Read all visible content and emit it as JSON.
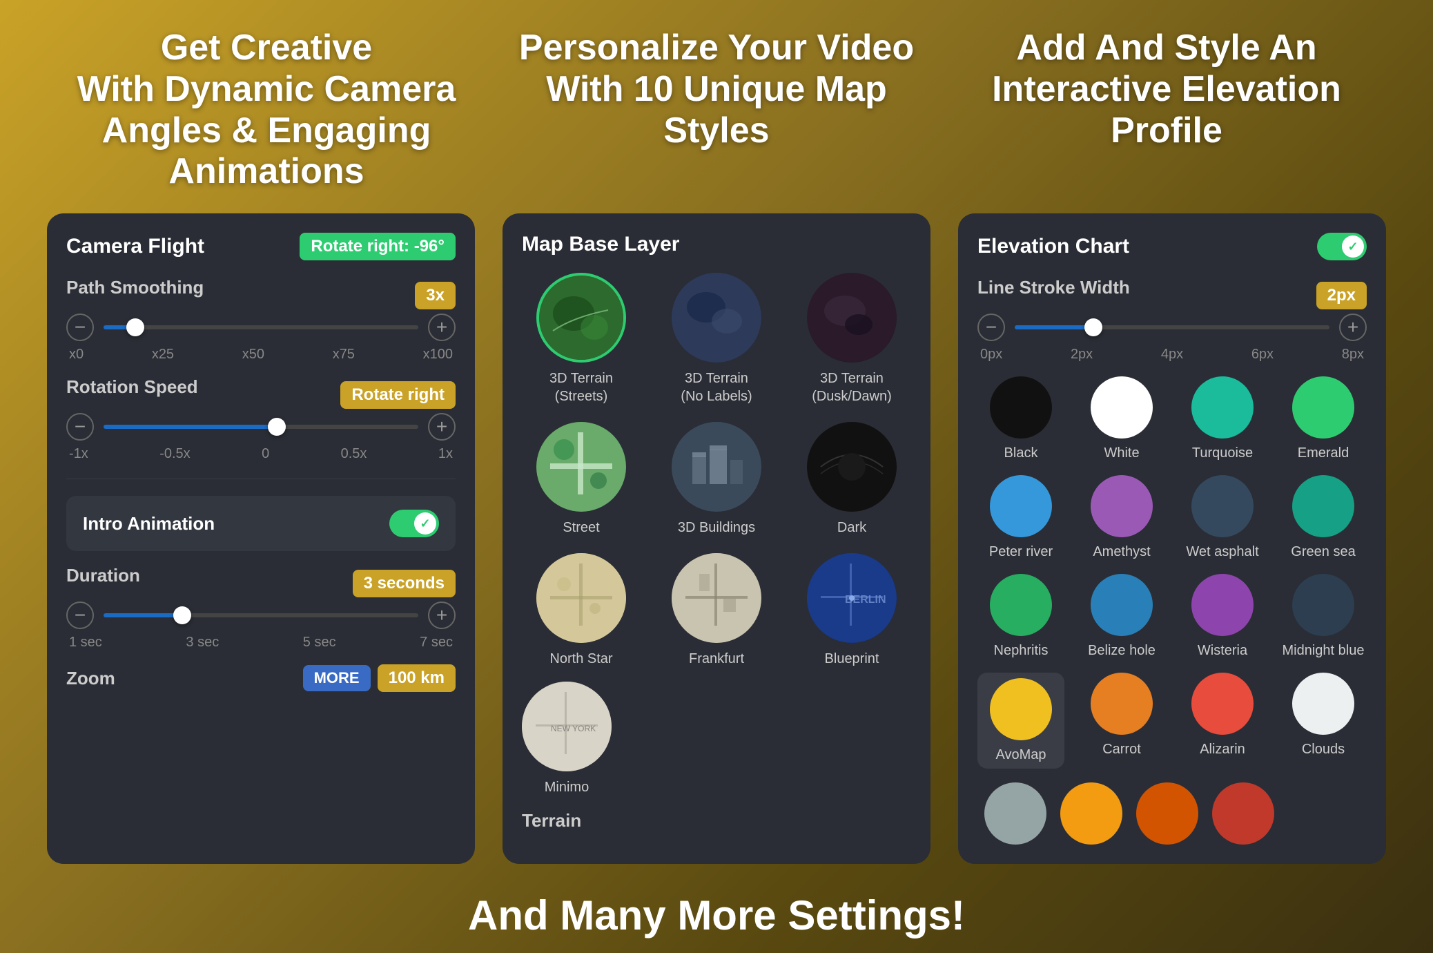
{
  "headers": [
    {
      "id": "camera",
      "title": "Get Creative\nWith Dynamic Camera\nAngles & Engaging Animations"
    },
    {
      "id": "map",
      "title": "Personalize Your Video\nWith 10 Unique Map Styles"
    },
    {
      "id": "elevation",
      "title": "Add  And Style An\nInteractive Elevation Profile"
    }
  ],
  "camera_card": {
    "title": "Camera Flight",
    "rotate_badge": "Rotate right: -96°",
    "path_smoothing_label": "Path Smoothing",
    "path_smoothing_value": "3x",
    "path_smoothing_marks": [
      "x0",
      "x25",
      "x50",
      "x75",
      "x100"
    ],
    "path_smoothing_thumb_pos": "10%",
    "rotation_speed_label": "Rotation Speed",
    "rotation_speed_value": "Rotate right",
    "rotation_marks": [
      "-1x",
      "-0.5x",
      "0",
      "0.5x",
      "1x"
    ],
    "rotation_thumb_pos": "55%",
    "intro_animation_label": "Intro Animation",
    "duration_label": "Duration",
    "duration_value": "3 seconds",
    "duration_marks": [
      "1 sec",
      "3 sec",
      "5 sec",
      "7 sec"
    ],
    "duration_thumb_pos": "25%",
    "zoom_label": "Zoom",
    "zoom_more": "MORE",
    "zoom_value": "100 km"
  },
  "map_card": {
    "title": "Map Base Layer",
    "items": [
      {
        "label": "3D Terrain\n(Streets)",
        "selected": true
      },
      {
        "label": "3D Terrain\n(No Labels)",
        "selected": false
      },
      {
        "label": "3D Terrain\n(Dusk/Dawn)",
        "selected": false
      },
      {
        "label": "Street",
        "selected": false
      },
      {
        "label": "3D Buildings",
        "selected": false
      },
      {
        "label": "Dark",
        "selected": false
      },
      {
        "label": "North Star",
        "selected": false
      },
      {
        "label": "Frankfurt",
        "selected": false
      },
      {
        "label": "Blueprint",
        "selected": false
      },
      {
        "label": "Minimo",
        "selected": false
      }
    ],
    "terrain_label": "Terrain"
  },
  "elevation_card": {
    "title": "Elevation Chart",
    "toggle_on": true,
    "line_stroke_label": "Line Stroke Width",
    "line_stroke_value": "2px",
    "stroke_marks": [
      "0px",
      "2px",
      "4px",
      "6px",
      "8px"
    ],
    "stroke_thumb_pos": "25%",
    "colors": [
      {
        "name": "Black",
        "hex": "#111111",
        "selected": false
      },
      {
        "name": "White",
        "hex": "#ffffff",
        "selected": false
      },
      {
        "name": "Turquoise",
        "hex": "#1abc9c",
        "selected": false
      },
      {
        "name": "Emerald",
        "hex": "#2ecc71",
        "selected": false
      },
      {
        "name": "Peter river",
        "hex": "#3498db",
        "selected": false
      },
      {
        "name": "Amethyst",
        "hex": "#9b59b6",
        "selected": false
      },
      {
        "name": "Wet asphalt",
        "hex": "#34495e",
        "selected": false
      },
      {
        "name": "Green sea",
        "hex": "#16a085",
        "selected": false
      },
      {
        "name": "Nephritis",
        "hex": "#27ae60",
        "selected": false
      },
      {
        "name": "Belize hole",
        "hex": "#2980b9",
        "selected": false
      },
      {
        "name": "Wisteria",
        "hex": "#8e44ad",
        "selected": false
      },
      {
        "name": "Midnight blue",
        "hex": "#2c3e50",
        "selected": false
      },
      {
        "name": "AvoMap",
        "hex": "#f0c020",
        "selected": true
      },
      {
        "name": "Carrot",
        "hex": "#e67e22",
        "selected": false
      },
      {
        "name": "Alizarin",
        "hex": "#e74c3c",
        "selected": false
      },
      {
        "name": "Clouds",
        "hex": "#ecf0f1",
        "selected": false
      }
    ],
    "extra_colors": [
      "#95a5a6",
      "#f39c12",
      "#d35400",
      "#c0392b"
    ]
  },
  "footer": {
    "text": "And Many More Settings!"
  }
}
